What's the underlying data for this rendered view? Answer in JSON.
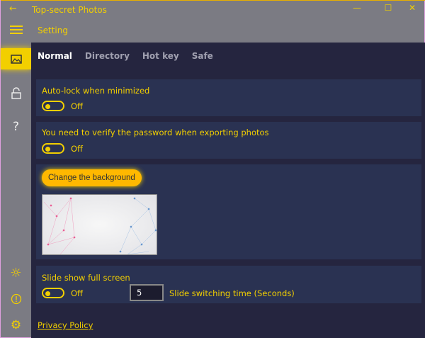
{
  "window": {
    "title": "Top-secret Photos",
    "back": "←",
    "minimize": "—",
    "maximize": "☐",
    "close": "✕"
  },
  "header": {
    "title": "Setting"
  },
  "sidebar": {
    "items": [
      {
        "icon": "image-icon",
        "glyph": "🖼"
      },
      {
        "icon": "lock-icon",
        "glyph": "🔓"
      },
      {
        "icon": "help-icon",
        "glyph": "?"
      },
      {
        "icon": "brightness-icon",
        "glyph": "☼"
      },
      {
        "icon": "info-icon",
        "glyph": "ⓘ"
      },
      {
        "icon": "settings-icon",
        "glyph": "⚙"
      }
    ]
  },
  "tabs": [
    "Normal",
    "Directory",
    "Hot key",
    "Safe"
  ],
  "settings": {
    "autolock": {
      "label": "Auto-lock when minimized",
      "state": "Off"
    },
    "verify": {
      "label": "You need to verify the password when exporting photos",
      "state": "Off"
    },
    "background": {
      "button": "Change the background"
    },
    "slideshow": {
      "label": "Slide show full screen",
      "state": "Off",
      "time_value": "5",
      "time_label": "Slide switching time (Seconds)"
    }
  },
  "footer": {
    "privacy": "Privacy Policy"
  },
  "colors": {
    "accent": "#f2cf00",
    "panel": "#25253f",
    "card": "#2a3252"
  }
}
